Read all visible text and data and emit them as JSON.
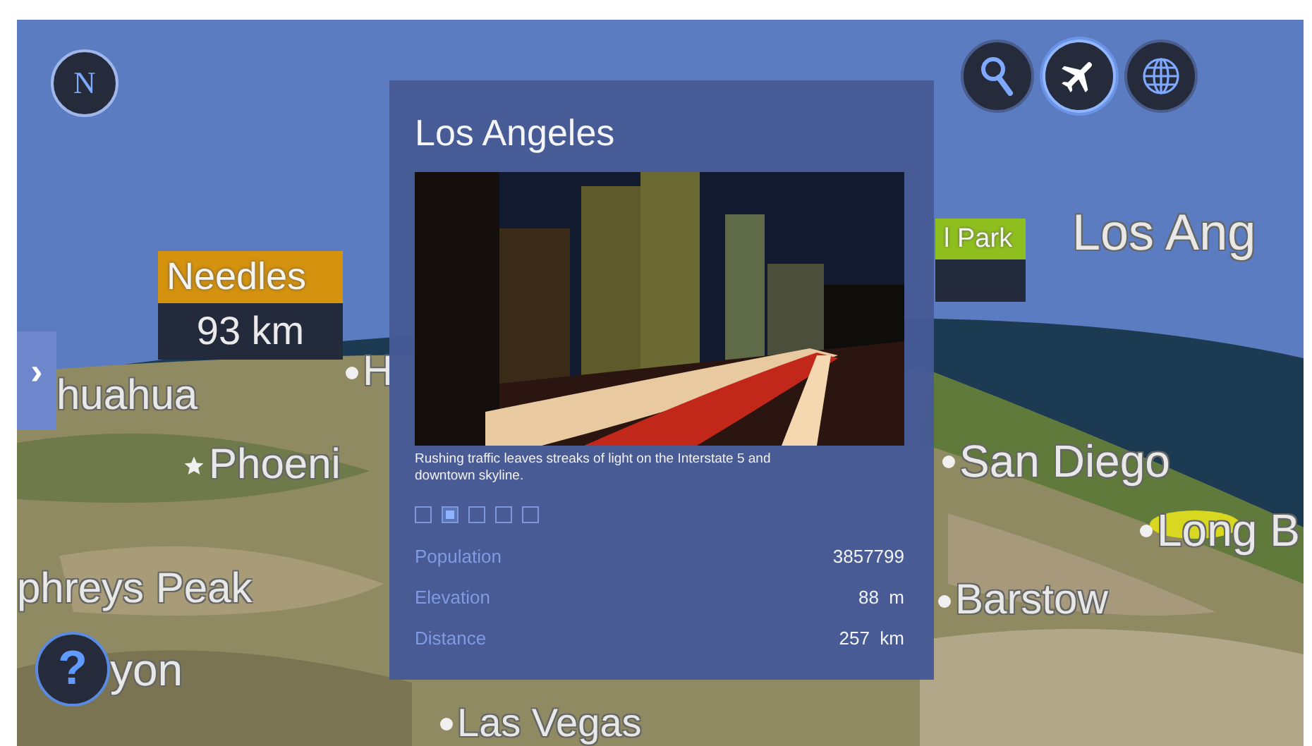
{
  "compass": {
    "label": "N"
  },
  "toolbar": [
    {
      "kind": "search",
      "selected": false
    },
    {
      "kind": "plane",
      "selected": true
    },
    {
      "kind": "globe",
      "selected": false
    }
  ],
  "side_tab": {
    "label": "›"
  },
  "help": {
    "label": "?"
  },
  "markers": [
    {
      "name": "Needles",
      "distance": "93 km",
      "color": "#d4920f"
    },
    {
      "name": "l Park",
      "color": "#8fbf1f"
    }
  ],
  "map_labels": [
    {
      "text": "huahua",
      "kind": "none"
    },
    {
      "text": "H",
      "kind": "dot"
    },
    {
      "text": "Phoeni",
      "kind": "star"
    },
    {
      "text": "phreys Peak",
      "kind": "none"
    },
    {
      "text": "yon",
      "kind": "none"
    },
    {
      "text": "Las Vegas",
      "kind": "dot"
    },
    {
      "text": "San Diego",
      "kind": "dot"
    },
    {
      "text": "Long B",
      "kind": "dot"
    },
    {
      "text": "Barstow",
      "kind": "dot"
    },
    {
      "text": "Los Ang",
      "kind": "none"
    }
  ],
  "info_panel": {
    "title": "Los Angeles",
    "caption": "Rushing traffic leaves streaks of light on the Interstate 5 and downtown skyline.",
    "pages": [
      {
        "selected": false
      },
      {
        "selected": true
      },
      {
        "selected": false
      },
      {
        "selected": false
      },
      {
        "selected": false
      }
    ],
    "stats": [
      {
        "label": "Population",
        "value": "3857799"
      },
      {
        "label": "Elevation",
        "value": "88  m"
      },
      {
        "label": "Distance",
        "value": "257  km"
      }
    ]
  }
}
